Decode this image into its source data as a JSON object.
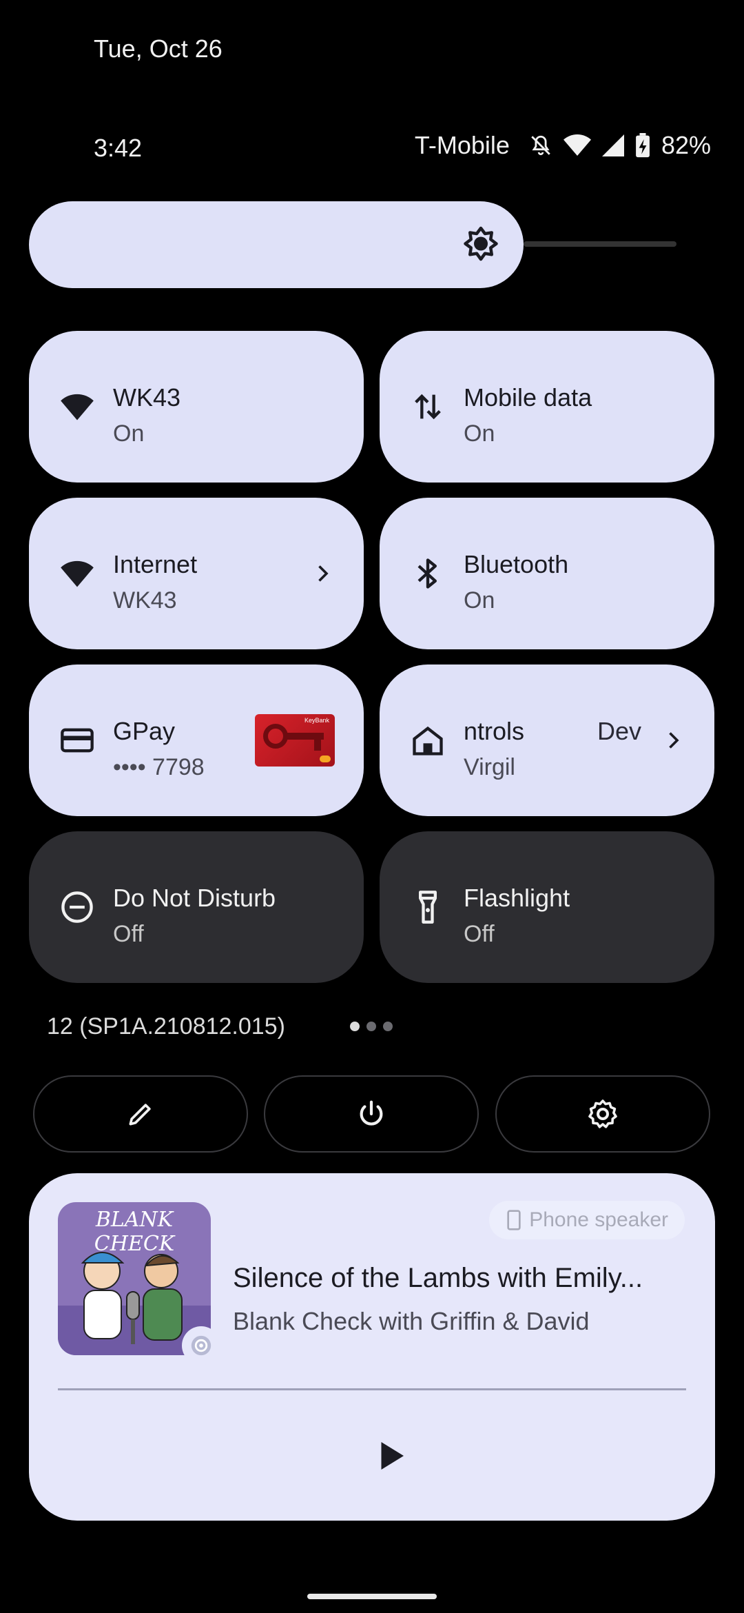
{
  "header": {
    "date": "Tue, Oct 26",
    "time": "3:42",
    "carrier": "T-Mobile",
    "battery": "82%",
    "icons": [
      "bell-off-icon",
      "wifi-icon",
      "cellular-signal-icon",
      "battery-charging-icon"
    ]
  },
  "brightness": {
    "icon": "brightness-icon"
  },
  "tiles": [
    {
      "title": "WK43",
      "subtitle": "On",
      "icon": "wifi-icon",
      "state": "on"
    },
    {
      "title": "Mobile data",
      "subtitle": "On",
      "icon": "mobile-data-icon",
      "state": "on"
    },
    {
      "title": "Internet",
      "subtitle": "WK43",
      "icon": "wifi-icon",
      "state": "on"
    },
    {
      "title": "Bluetooth",
      "subtitle": "On",
      "icon": "bluetooth-icon",
      "state": "on"
    },
    {
      "title": "GPay",
      "subtitle": "•••• 7798",
      "icon": "card-icon",
      "state": "on"
    },
    {
      "title": "ntrols",
      "title_extra": "Dev",
      "subtitle": "Virgil",
      "icon": "home-icon",
      "state": "on"
    },
    {
      "title": "Do Not Disturb",
      "subtitle": "Off",
      "icon": "do-not-disturb-icon",
      "state": "off"
    },
    {
      "title": "Flashlight",
      "subtitle": "Off",
      "icon": "flashlight-icon",
      "state": "off"
    }
  ],
  "gpay_card": {
    "brand_text": "KeyBank"
  },
  "build": {
    "number": "12 (SP1A.210812.015)",
    "page_count": 3,
    "page_active": 1
  },
  "actions": [
    {
      "icon": "edit-icon"
    },
    {
      "icon": "power-icon"
    },
    {
      "icon": "settings-icon"
    }
  ],
  "media": {
    "art_title": "BLANK CHECK",
    "output": "Phone speaker",
    "title": "Silence of the Lambs with Emily...",
    "subtitle": "Blank Check with Griffin & David",
    "play_icon": "play-icon"
  },
  "colors": {
    "tile_on": "#dfe1f8",
    "tile_off": "#2d2d31",
    "media_bg": "#e6e7fa",
    "background": "#000000"
  }
}
